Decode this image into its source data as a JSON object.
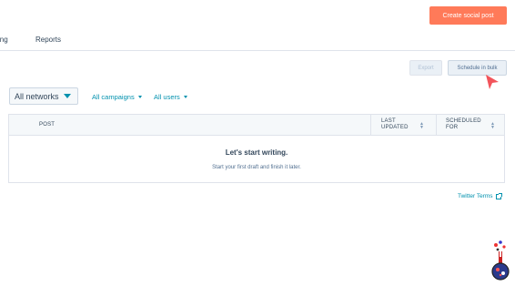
{
  "header": {
    "tab_partial": "ing",
    "tab_reports": "Reports",
    "create_label": "Create social post"
  },
  "toolbar": {
    "export_label": "Export",
    "bulk_label": "Schedule in bulk"
  },
  "filters": {
    "networks": "All networks",
    "campaigns": "All campaigns",
    "users": "All users"
  },
  "table": {
    "columns": [
      "POST",
      "LAST UPDATED",
      "SCHEDULED FOR"
    ],
    "empty_title": "Let's start writing.",
    "empty_subtitle": "Start your first draft and finish it later."
  },
  "footer": {
    "twitter_terms": "Twitter Terms"
  },
  "colors": {
    "primary": "#ff7a59",
    "link": "#0091ae",
    "cursor": "#f2545b"
  },
  "icons": [
    "caret-down-icon",
    "sort-icon",
    "external-link-icon",
    "cursor-arrow-icon",
    "mascot-icon"
  ]
}
